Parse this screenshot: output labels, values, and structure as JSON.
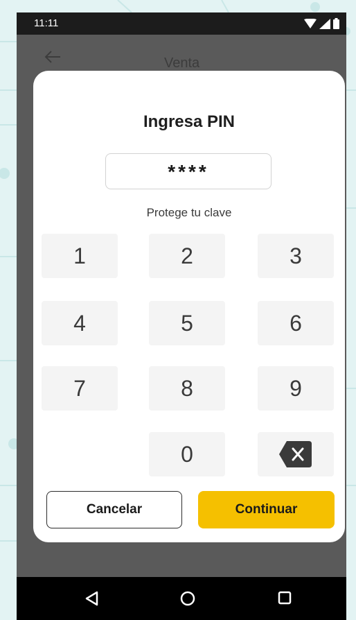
{
  "status_bar": {
    "time": "11:11"
  },
  "header": {
    "title": "Venta"
  },
  "dialog": {
    "title": "Ingresa PIN",
    "pin_value": "****",
    "hint": "Protege tu clave",
    "keys": [
      "1",
      "2",
      "3",
      "4",
      "5",
      "6",
      "7",
      "8",
      "9",
      "0"
    ],
    "cancel_label": "Cancelar",
    "continue_label": "Continuar"
  },
  "icons": {
    "back": "arrow-left-icon",
    "backspace": "backspace-icon",
    "nav_back": "triangle-back-icon",
    "nav_home": "circle-home-icon",
    "nav_recents": "square-recents-icon"
  },
  "colors": {
    "accent": "#f5c000",
    "overlay": "#5a5a5a",
    "key_bg": "#f4f4f4"
  }
}
